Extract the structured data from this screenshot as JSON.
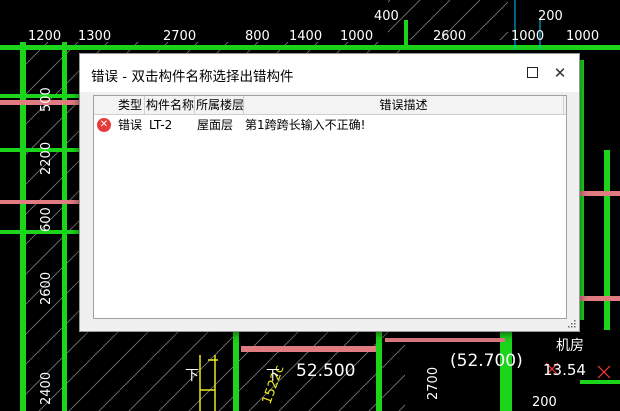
{
  "cad": {
    "top_dims": [
      "1200",
      "1300",
      "2700",
      "800",
      "1400",
      "1000",
      "2600",
      "1000",
      "1000"
    ],
    "upper_dims": [
      "400",
      "200"
    ],
    "left_dims": [
      "500",
      "2200",
      "600",
      "2600",
      "2400"
    ],
    "bottom_labels": [
      "52.500",
      "(52.700)",
      "2700",
      "机房",
      "13.54",
      "200",
      "1522c",
      "下",
      "下"
    ]
  },
  "dialog": {
    "title": "错误 - 双击构件名称选择出错构件",
    "columns": [
      "类型",
      "构件名称",
      "所属楼层",
      "错误描述"
    ],
    "rows": [
      {
        "type": "错误",
        "name": "LT-2",
        "floor": "屋面层",
        "desc": "第1跨跨长输入不正确!",
        "icon": "error-icon"
      }
    ]
  },
  "colors": {
    "cad_green": "#1bd51b",
    "cad_pink": "#e07b82",
    "cad_yellow": "#e8e820",
    "cad_red": "#ff3b3b",
    "error_red": "#e43b3b"
  }
}
